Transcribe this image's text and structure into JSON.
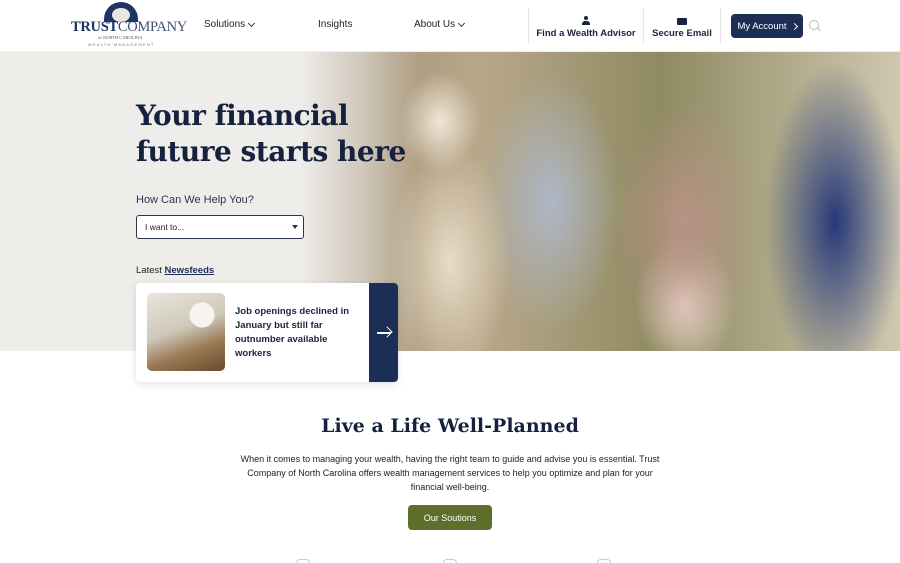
{
  "header": {
    "logo": {
      "brand_bold": "TRUST",
      "brand_light": "COMPANY",
      "subline": "of NORTH CAROLINA",
      "tagline": "WEALTH MANAGEMENT"
    },
    "nav": [
      {
        "label": "Solutions",
        "has_dropdown": true
      },
      {
        "label": "Insights",
        "has_dropdown": false
      },
      {
        "label": "About Us",
        "has_dropdown": true
      }
    ],
    "utility": [
      {
        "label": "Find a Wealth Advisor",
        "icon": "person-icon"
      },
      {
        "label": "Secure Email",
        "icon": "envelope-icon"
      }
    ],
    "account_button": "My Account",
    "search_icon": "search-icon"
  },
  "hero": {
    "title_line1": "Your financial",
    "title_line2": "future starts here",
    "help_label": "How Can We Help You?",
    "select_value": "I want to...",
    "news_prefix": "Latest",
    "news_link": "Newsfeeds",
    "news_card": {
      "headline": "Job openings declined in January but still far outnumber available workers"
    }
  },
  "intro": {
    "title": "Live a Life Well-Planned",
    "body": "When it comes to managing your wealth, having the right team to guide and advise you is essential. Trust Company of North Carolina offers wealth management services to help you optimize and plan for your financial well-being.",
    "button": "Our Soutions"
  },
  "colors": {
    "navy": "#1c2e55",
    "olive": "#5d6f2a",
    "hero_bg": "#efedea"
  }
}
